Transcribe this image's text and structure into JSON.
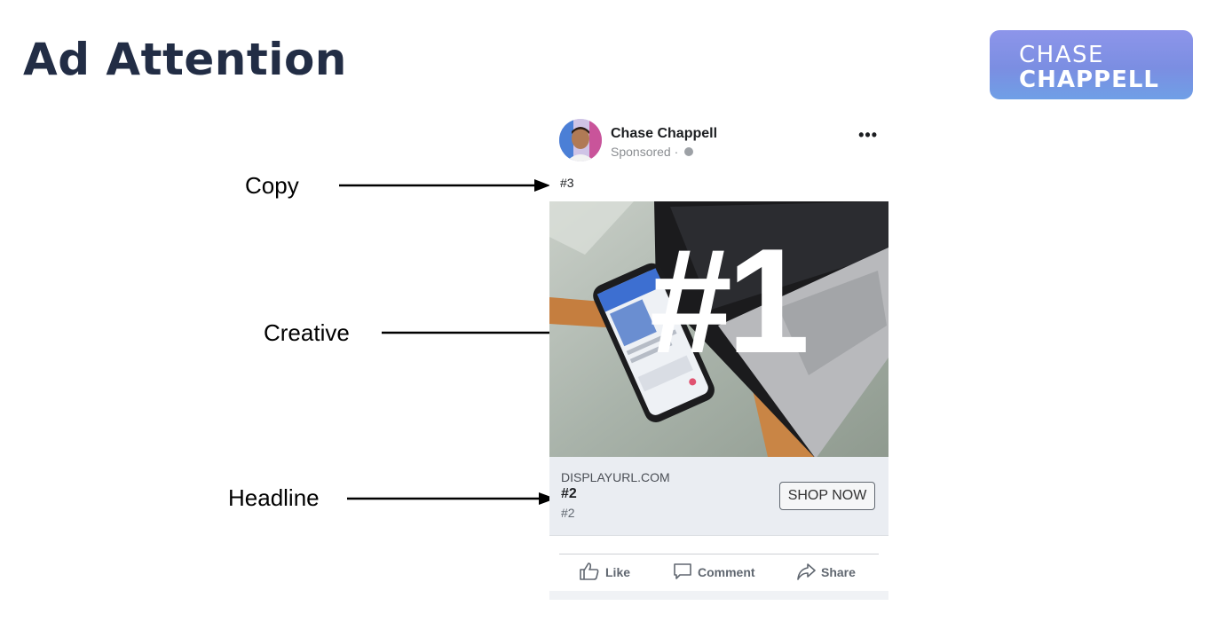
{
  "slide": {
    "title": "Ad Attention"
  },
  "logo": {
    "line1": "CHASE",
    "line2": "CHAPPELL"
  },
  "annotations": {
    "copy": "Copy",
    "creative": "Creative",
    "headline": "Headline"
  },
  "post": {
    "author": "Chase Chappell",
    "sponsored": "Sponsored · ",
    "more": "•••",
    "copy_text": "#3",
    "creative_label": "#1",
    "display_url": "DISPLAYURL.COM",
    "headline": "#2",
    "description": "#2",
    "cta": "SHOP NOW",
    "actions": {
      "like": "Like",
      "comment": "Comment",
      "share": "Share"
    }
  }
}
